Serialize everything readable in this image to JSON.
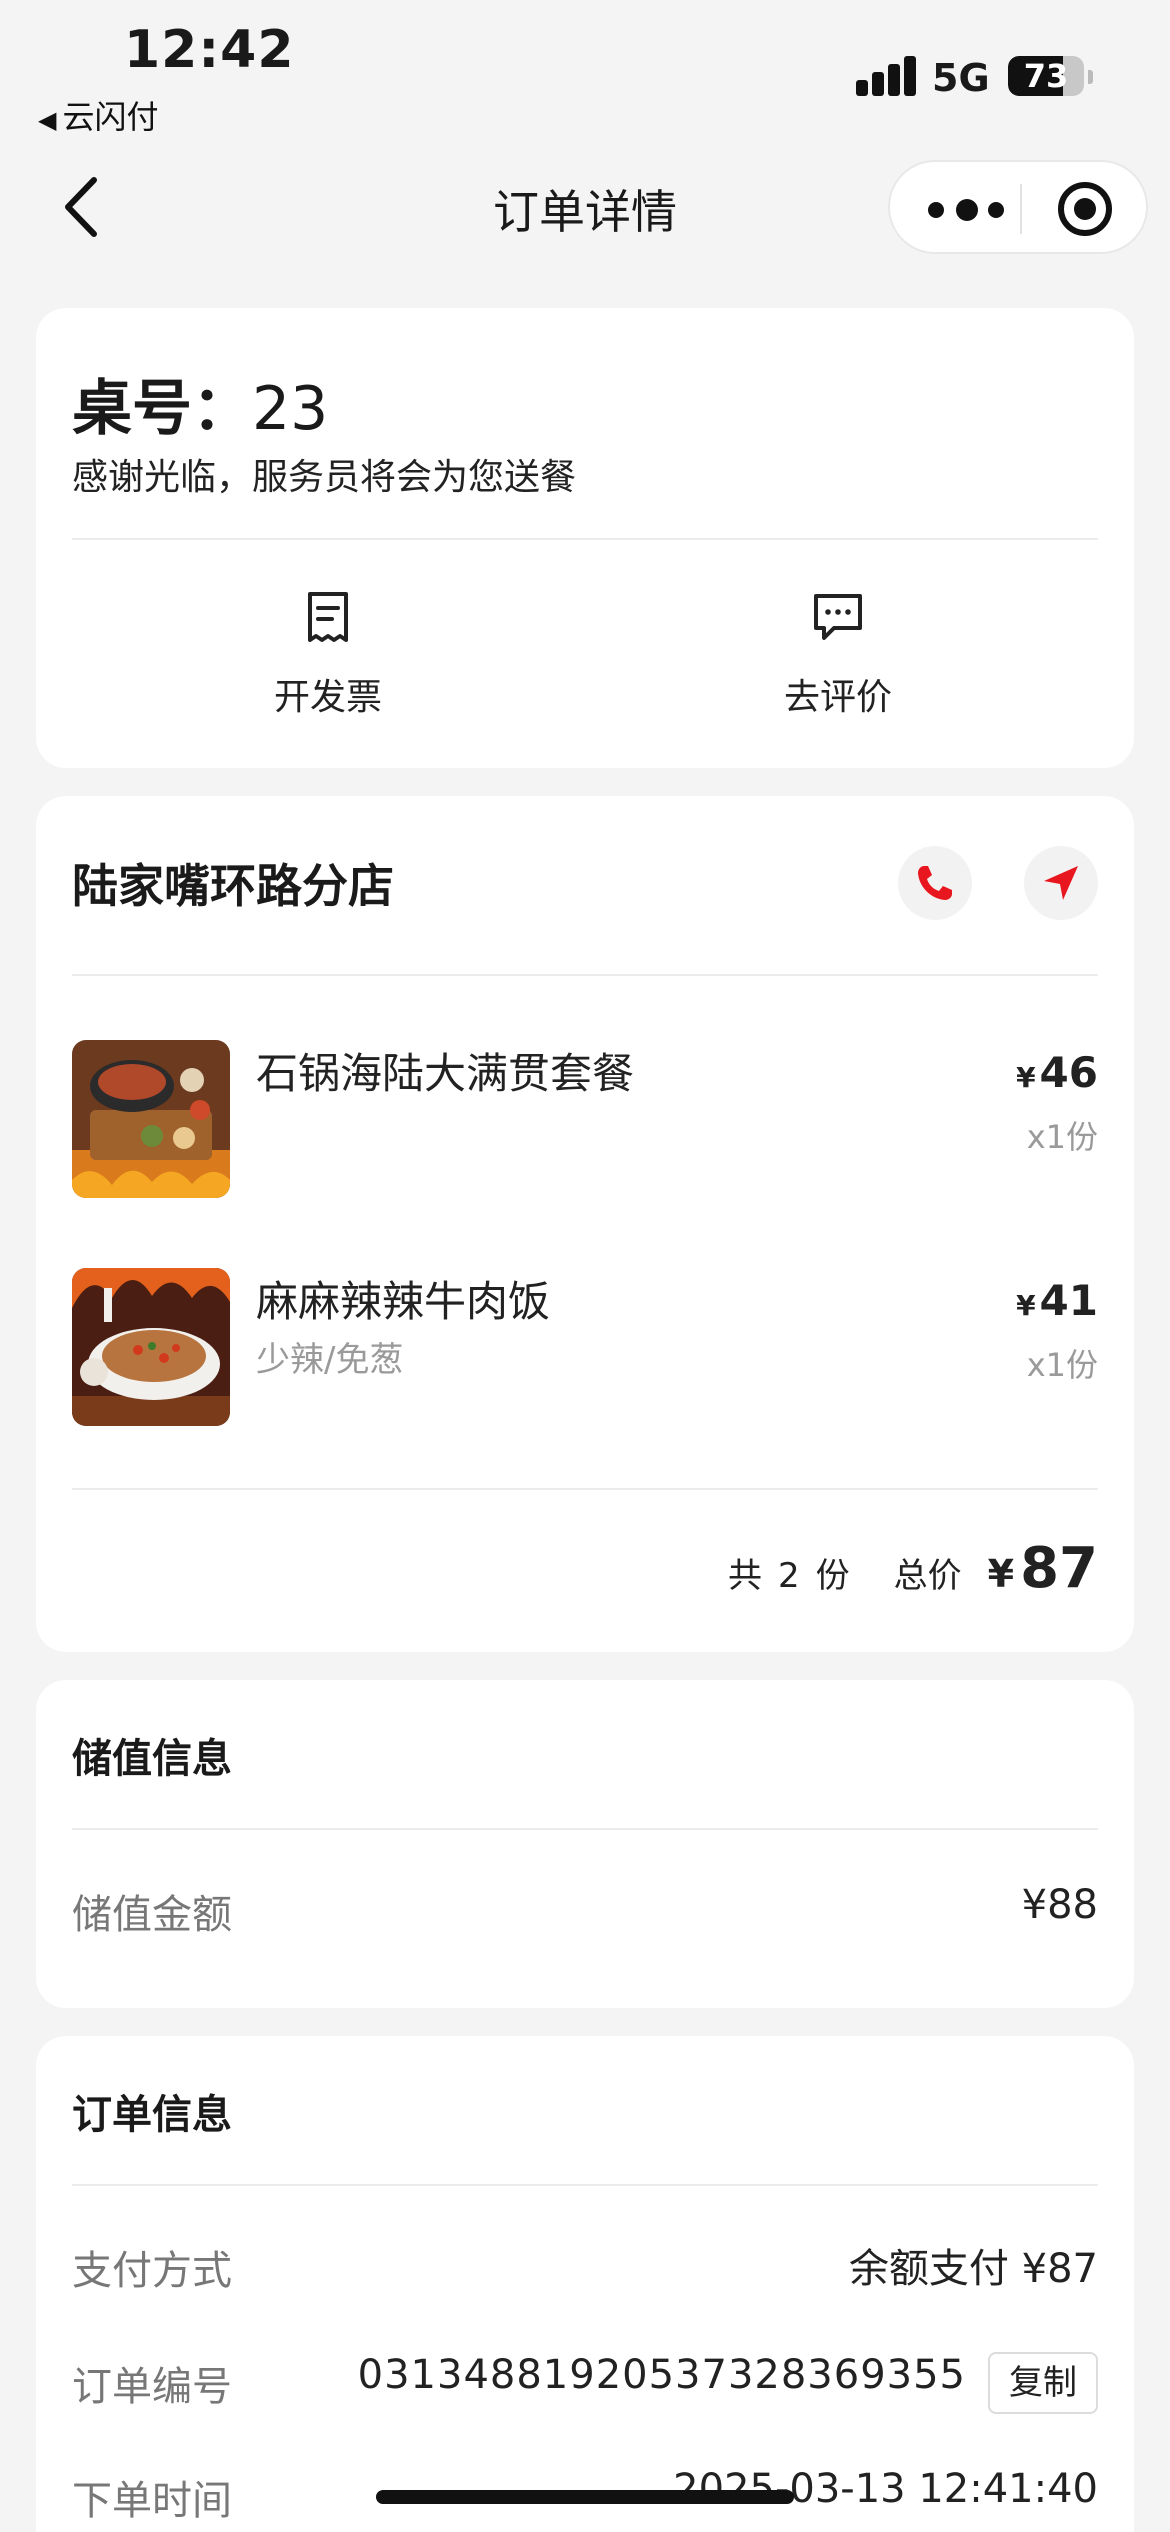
{
  "status_bar": {
    "time": "12:42",
    "back_app": "云闪付",
    "network": "5G",
    "battery": "73",
    "battery_level": 0.73
  },
  "nav": {
    "title": "订单详情"
  },
  "table_card": {
    "table_label": "桌号：",
    "table_number": "23",
    "message": "感谢光临，服务员将会为您送餐",
    "invoice_label": "开发票",
    "review_label": "去评价"
  },
  "order_card": {
    "store_name": "陆家嘴环路分店",
    "items": [
      {
        "name": "石锅海陆大满贯套餐",
        "note": "",
        "currency": "¥",
        "price": "46",
        "qty": "x1份"
      },
      {
        "name": "麻麻辣辣牛肉饭",
        "note": "少辣/免葱",
        "currency": "¥",
        "price": "41",
        "qty": "x1份"
      }
    ],
    "count_prefix": "共",
    "count": "2",
    "count_suffix": "份",
    "total_label": "总价",
    "total_currency": "¥",
    "total": "87"
  },
  "stored_value": {
    "title": "储值信息",
    "amount_label": "储值金额",
    "amount_value": "¥88"
  },
  "order_info": {
    "title": "订单信息",
    "payment_label": "支付方式",
    "payment_value": "余额支付 ¥87",
    "order_no_label": "订单编号",
    "order_no_value": "0313488192053732836935​5",
    "copy_label": "复制",
    "time_label": "下单时间",
    "time_value": "2025-03-13 12:41:40"
  },
  "colors": {
    "accent_red": "#e8161e",
    "background": "#f4f4f4"
  }
}
